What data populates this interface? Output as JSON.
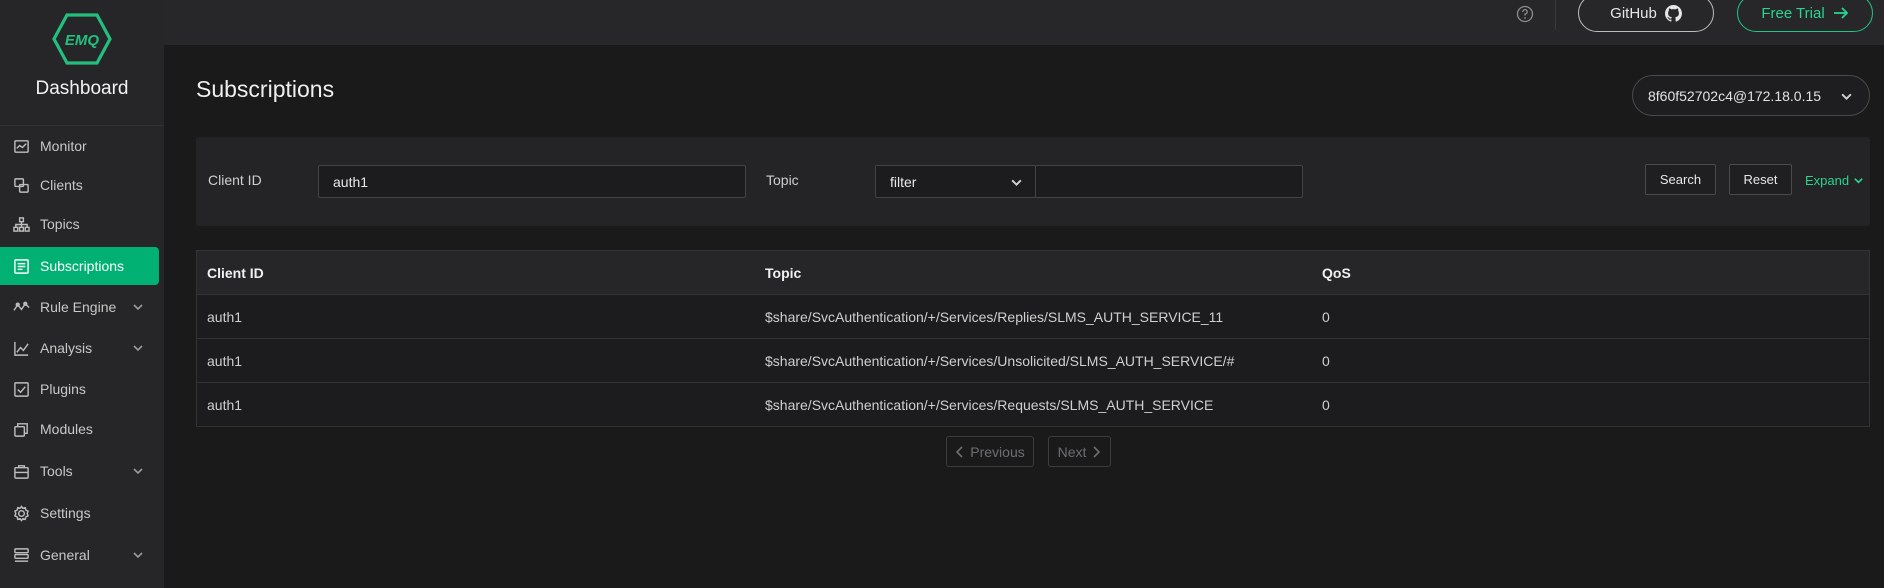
{
  "brand": {
    "logo_text": "EMQ",
    "title": "Dashboard"
  },
  "sidebar": {
    "items": [
      {
        "label": "Monitor",
        "icon": "monitor-icon",
        "expandable": false,
        "active": false
      },
      {
        "label": "Clients",
        "icon": "clients-icon",
        "expandable": false,
        "active": false
      },
      {
        "label": "Topics",
        "icon": "topics-icon",
        "expandable": false,
        "active": false
      },
      {
        "label": "Subscriptions",
        "icon": "subscriptions-icon",
        "expandable": false,
        "active": true
      },
      {
        "label": "Rule Engine",
        "icon": "rule-engine-icon",
        "expandable": true,
        "active": false
      },
      {
        "label": "Analysis",
        "icon": "analysis-icon",
        "expandable": true,
        "active": false
      },
      {
        "label": "Plugins",
        "icon": "plugins-icon",
        "expandable": false,
        "active": false
      },
      {
        "label": "Modules",
        "icon": "modules-icon",
        "expandable": false,
        "active": false
      },
      {
        "label": "Tools",
        "icon": "tools-icon",
        "expandable": true,
        "active": false
      },
      {
        "label": "Settings",
        "icon": "settings-icon",
        "expandable": false,
        "active": false
      },
      {
        "label": "General",
        "icon": "general-icon",
        "expandable": true,
        "active": false
      }
    ]
  },
  "topbar": {
    "help_icon": "help-circle-icon",
    "github_label": "GitHub",
    "trial_label": "Free Trial"
  },
  "main": {
    "title": "Subscriptions",
    "node": "8f60f52702c4@172.18.0.15"
  },
  "filters": {
    "client_id_label": "Client ID",
    "client_id_value": "auth1",
    "topic_label": "Topic",
    "topic_match_value": "filter",
    "topic_value": "",
    "search_label": "Search",
    "reset_label": "Reset",
    "expand_label": "Expand"
  },
  "table": {
    "columns": [
      "Client ID",
      "Topic",
      "QoS"
    ],
    "rows": [
      {
        "client_id": "auth1",
        "topic": "$share/SvcAuthentication/+/Services/Replies/SLMS_AUTH_SERVICE_11",
        "qos": "0"
      },
      {
        "client_id": "auth1",
        "topic": "$share/SvcAuthentication/+/Services/Unsolicited/SLMS_AUTH_SERVICE/#",
        "qos": "0"
      },
      {
        "client_id": "auth1",
        "topic": "$share/SvcAuthentication/+/Services/Requests/SLMS_AUTH_SERVICE",
        "qos": "0"
      }
    ]
  },
  "pagination": {
    "prev_label": "Previous",
    "next_label": "Next"
  },
  "colors": {
    "accent": "#00b173",
    "accent_text": "#28d48f",
    "background": "#1a1a1b",
    "sidebar": "#262628"
  }
}
